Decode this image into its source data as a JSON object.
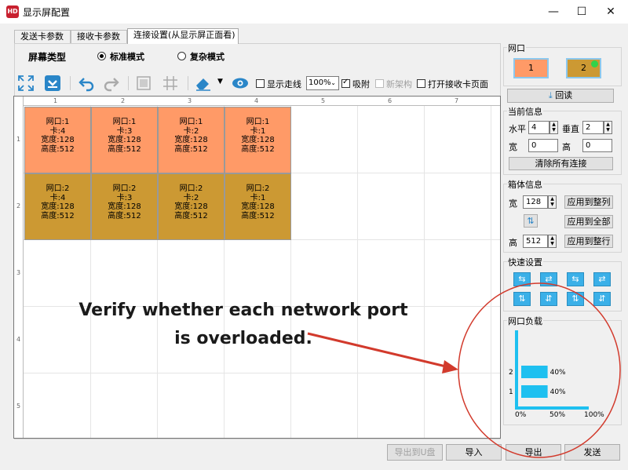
{
  "window": {
    "title": "显示屏配置",
    "logo": "HD"
  },
  "tabs": [
    "发送卡参数",
    "接收卡参数",
    "连接设置(从显示屏正面看)"
  ],
  "screen_type": {
    "label": "屏幕类型",
    "modes": [
      "标准模式",
      "复杂模式"
    ],
    "selected": "标准模式"
  },
  "toolbar": {
    "icons": [
      "expand-icon",
      "download-icon",
      "undo-icon",
      "redo-icon",
      "frame-icon",
      "grid-icon",
      "eraser-icon",
      "dropdown-icon",
      "eye-icon"
    ],
    "show_route": "显示走线",
    "zoom": "100%",
    "snap": "吸附",
    "new_arch": "新架构",
    "open_recv": "打开接收卡页面"
  },
  "ruler": {
    "cols": [
      "1",
      "2",
      "3",
      "4",
      "5",
      "6",
      "7"
    ],
    "rows": [
      "1",
      "2",
      "3",
      "4",
      "5"
    ]
  },
  "cells": [
    {
      "port": "网口:1",
      "card": "卡:4",
      "width": "宽度:128",
      "height": "高度:512",
      "color": "#ff9a67"
    },
    {
      "port": "网口:1",
      "card": "卡:3",
      "width": "宽度:128",
      "height": "高度:512",
      "color": "#ff9a67"
    },
    {
      "port": "网口:1",
      "card": "卡:2",
      "width": "宽度:128",
      "height": "高度:512",
      "color": "#ff9a67"
    },
    {
      "port": "网口:1",
      "card": "卡:1",
      "width": "宽度:128",
      "height": "高度:512",
      "color": "#ff9a67"
    },
    {
      "port": "网口:2",
      "card": "卡:4",
      "width": "宽度:128",
      "height": "高度:512",
      "color": "#cc9933"
    },
    {
      "port": "网口:2",
      "card": "卡:3",
      "width": "宽度:128",
      "height": "高度:512",
      "color": "#cc9933"
    },
    {
      "port": "网口:2",
      "card": "卡:2",
      "width": "宽度:128",
      "height": "高度:512",
      "color": "#cc9933"
    },
    {
      "port": "网口:2",
      "card": "卡:1",
      "width": "宽度:128",
      "height": "高度:512",
      "color": "#cc9933"
    }
  ],
  "port_panel": {
    "label": "网口",
    "ports": [
      "1",
      "2"
    ],
    "readback": "回读"
  },
  "current_info": {
    "label": "当前信息",
    "horizontal_label": "水平",
    "horizontal": "4",
    "vertical_label": "垂直",
    "vertical": "2",
    "width_label": "宽",
    "width": "0",
    "height_label": "高",
    "height": "0",
    "clear": "清除所有连接"
  },
  "box_info": {
    "label": "箱体信息",
    "width_label": "宽",
    "width": "128",
    "height_label": "高",
    "height": "512",
    "apply_col": "应用到整列",
    "apply_all": "应用到全部",
    "apply_row": "应用到整行"
  },
  "quick": {
    "label": "快速设置"
  },
  "port_load": {
    "label": "网口负载",
    "rows": [
      "2",
      "1"
    ],
    "values_text": [
      "40%",
      "40%"
    ],
    "axis": [
      "0%",
      "50%",
      "100%"
    ]
  },
  "chart_data": {
    "type": "bar",
    "categories": [
      "2",
      "1"
    ],
    "values": [
      40,
      40
    ],
    "xlim": [
      0,
      100
    ],
    "orientation": "horizontal"
  },
  "annotation": [
    "Verify whether each network port",
    "is overloaded."
  ],
  "bottom_buttons": {
    "export_usb": "导出到U盘",
    "import": "导入",
    "export": "导出",
    "send": "发送"
  }
}
